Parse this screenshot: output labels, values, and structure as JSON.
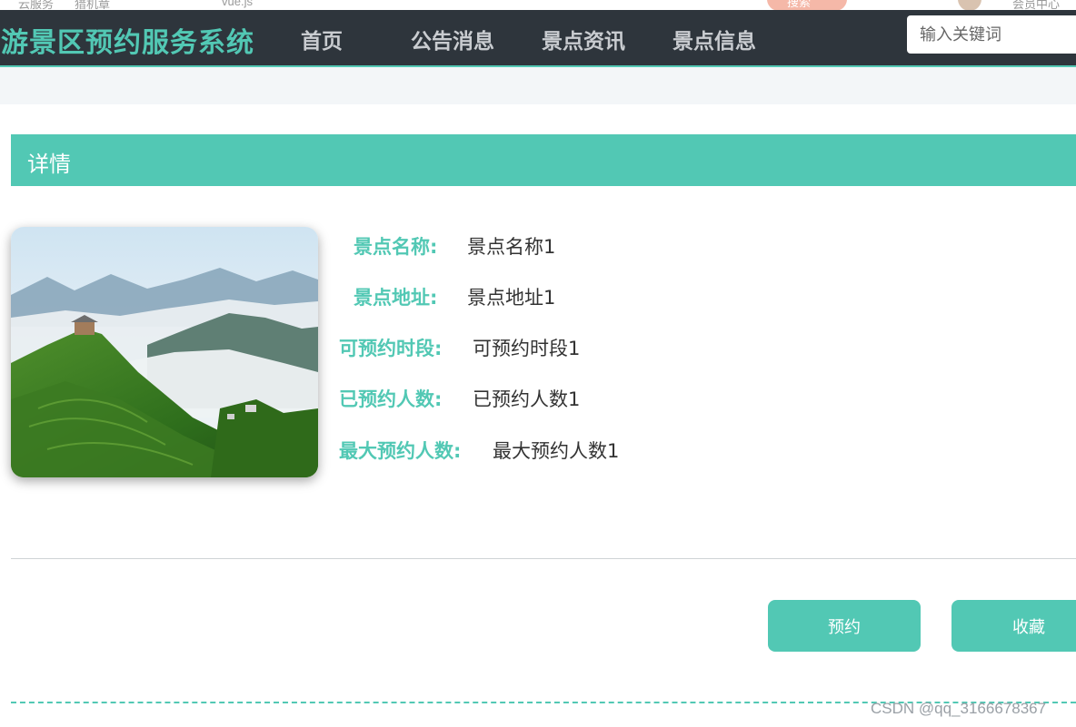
{
  "browser_strip": {
    "item1": "云服务",
    "item2": "猎机章",
    "item3": "vue.js",
    "search_label": "搜索",
    "member_center": "会员中心"
  },
  "nav": {
    "brand": "旅游景区预约服务系统",
    "items": [
      {
        "label": "首页"
      },
      {
        "label": "公告消息"
      },
      {
        "label": "景点资讯"
      },
      {
        "label": "景点信息"
      }
    ],
    "search_placeholder": "输入关键词"
  },
  "detail": {
    "header": "详情",
    "fields": [
      {
        "label": "景点名称:",
        "value": "景点名称1"
      },
      {
        "label": "景点地址:",
        "value": "景点地址1"
      },
      {
        "label": "可预约时段:",
        "value": "可预约时段1"
      },
      {
        "label": "已预约人数:",
        "value": "已预约人数1"
      },
      {
        "label": "最大预约人数:",
        "value": "最大预约人数1"
      }
    ]
  },
  "actions": {
    "book": "预约",
    "favorite": "收藏"
  },
  "watermark": "CSDN @qq_3166678367",
  "colors": {
    "accent": "#52c8b4",
    "nav_bg": "#2e353c",
    "nav_text": "#c9ccd0",
    "page_bg": "#ffffff"
  }
}
